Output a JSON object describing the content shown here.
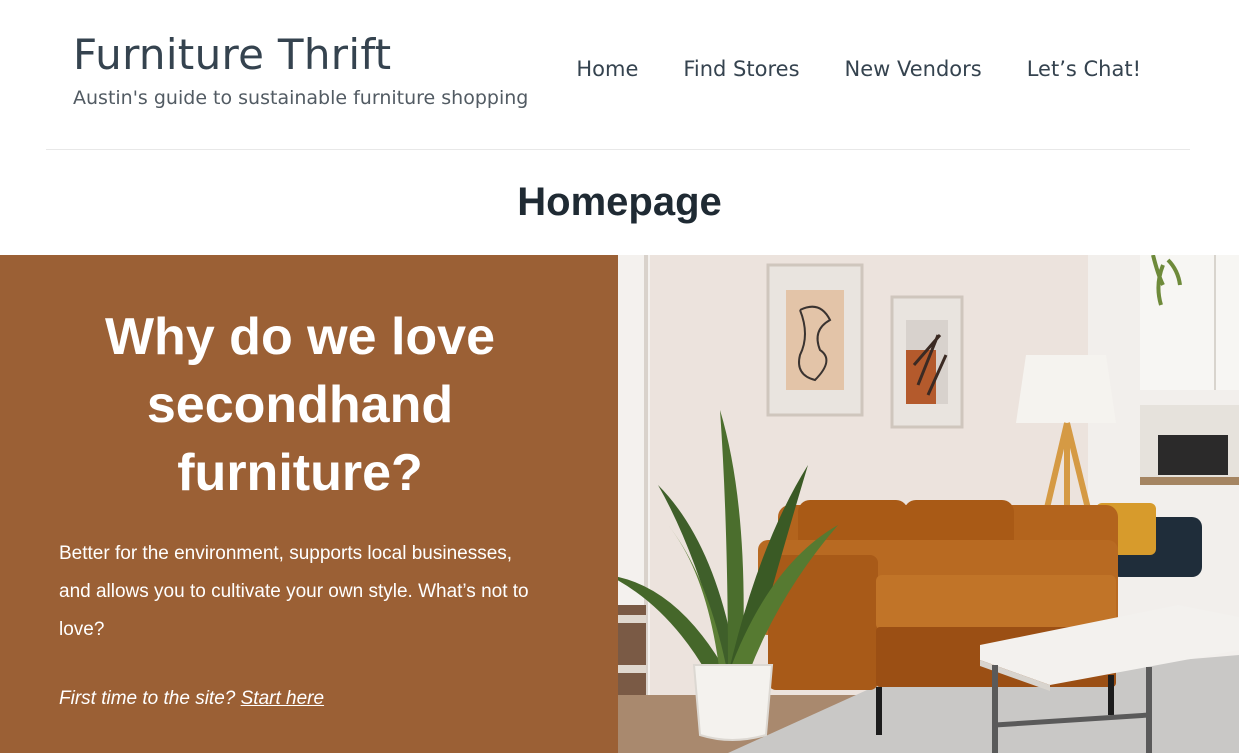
{
  "site": {
    "title": "Furniture Thrift",
    "tagline": "Austin's guide to sustainable furniture shopping"
  },
  "nav": {
    "items": [
      {
        "label": "Home"
      },
      {
        "label": "Find Stores"
      },
      {
        "label": "New Vendors"
      },
      {
        "label": "Let’s Chat!"
      }
    ]
  },
  "page": {
    "title": "Homepage"
  },
  "hero": {
    "heading_line1": "Why do we love",
    "heading_line2": "secondhand",
    "heading_line3": "furniture?",
    "body": "Better for the environment, supports local businesses, and allows you to cultivate your own style. What’s not to love?",
    "cta_prefix": "First time to the site?",
    "cta_link": "Start here",
    "background_color": "#9b6035"
  },
  "colors": {
    "text_dark": "#35434f",
    "accent_brown": "#9b6035",
    "white": "#ffffff"
  }
}
